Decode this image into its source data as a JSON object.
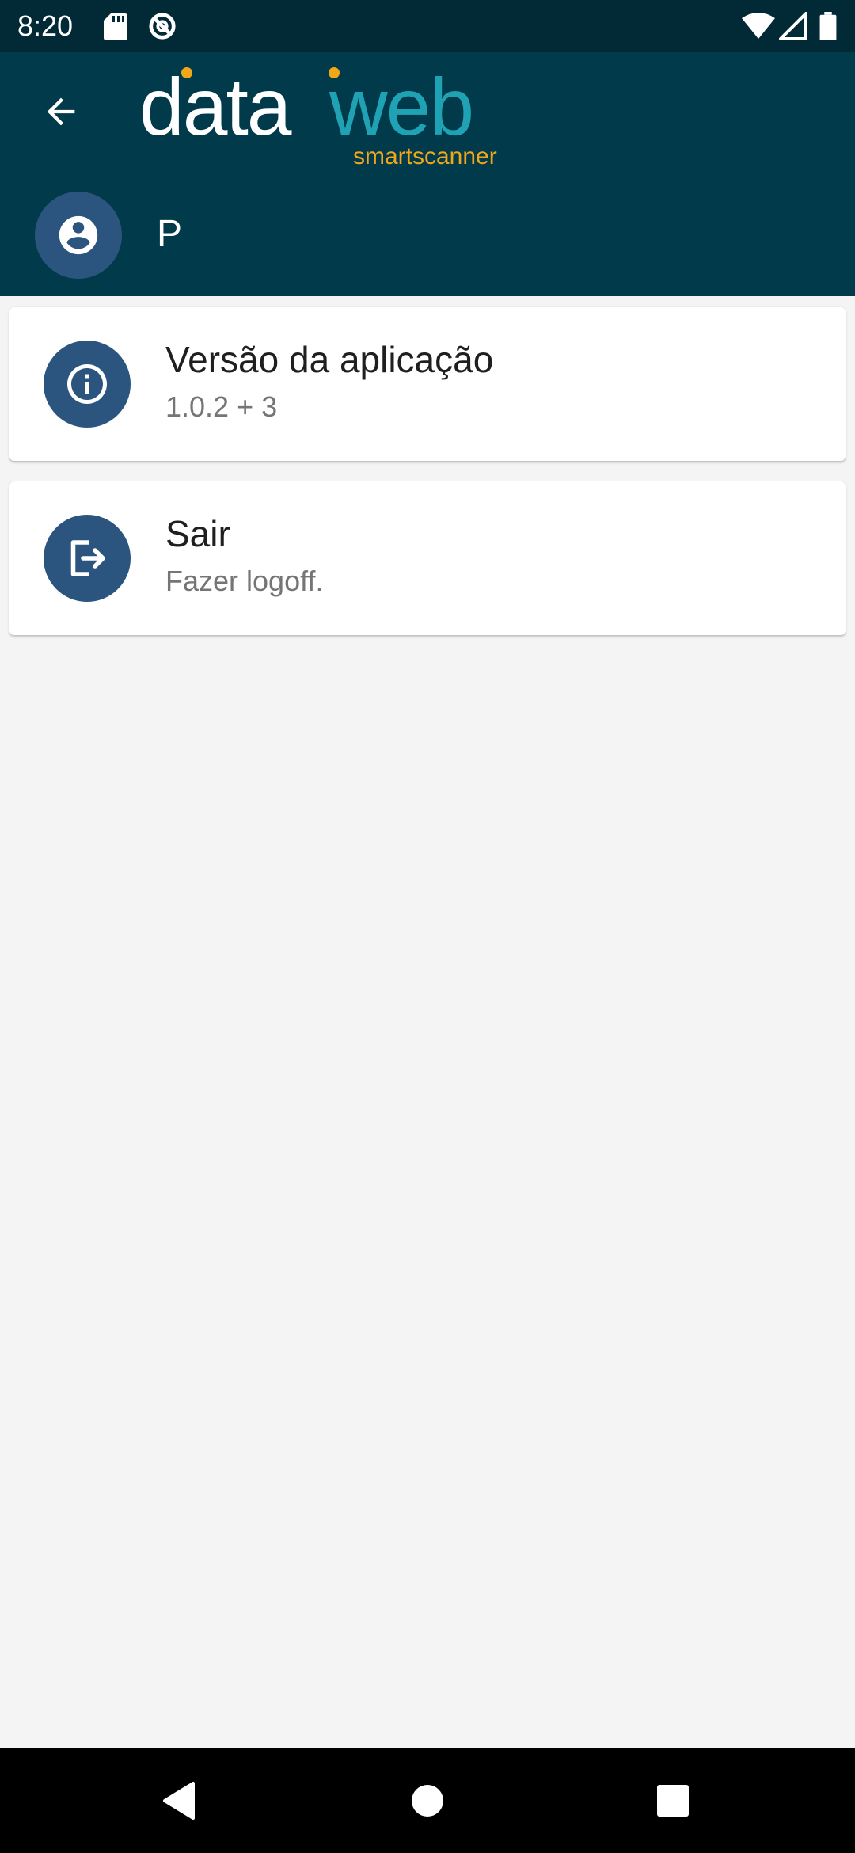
{
  "status_bar": {
    "time": "8:20",
    "left_icons": [
      "sd-card-icon",
      "do-not-disturb-icon"
    ],
    "right_icons": [
      "wifi-icon",
      "signal-icon",
      "battery-icon"
    ]
  },
  "header": {
    "back_icon": "arrow-back-icon",
    "logo": {
      "brand_left": "data",
      "brand_right": "web",
      "tagline": "smartscanner"
    },
    "user": {
      "avatar_icon": "account-circle-icon",
      "name": "P"
    }
  },
  "cards": [
    {
      "icon": "info-icon",
      "title": "Versão da aplicação",
      "subtitle": "1.0.2 + 3"
    },
    {
      "icon": "logout-icon",
      "title": "Sair",
      "subtitle": "Fazer logoff."
    }
  ],
  "navigation_bar": {
    "buttons": [
      "back-icon",
      "home-icon",
      "recents-icon"
    ]
  },
  "colors": {
    "status_bar": "#012a36",
    "header": "#013a4b",
    "icon_circle": "#2b557e",
    "logo_teal": "#1fa3b4",
    "logo_orange": "#f2a71b",
    "background": "#f4f4f4"
  }
}
